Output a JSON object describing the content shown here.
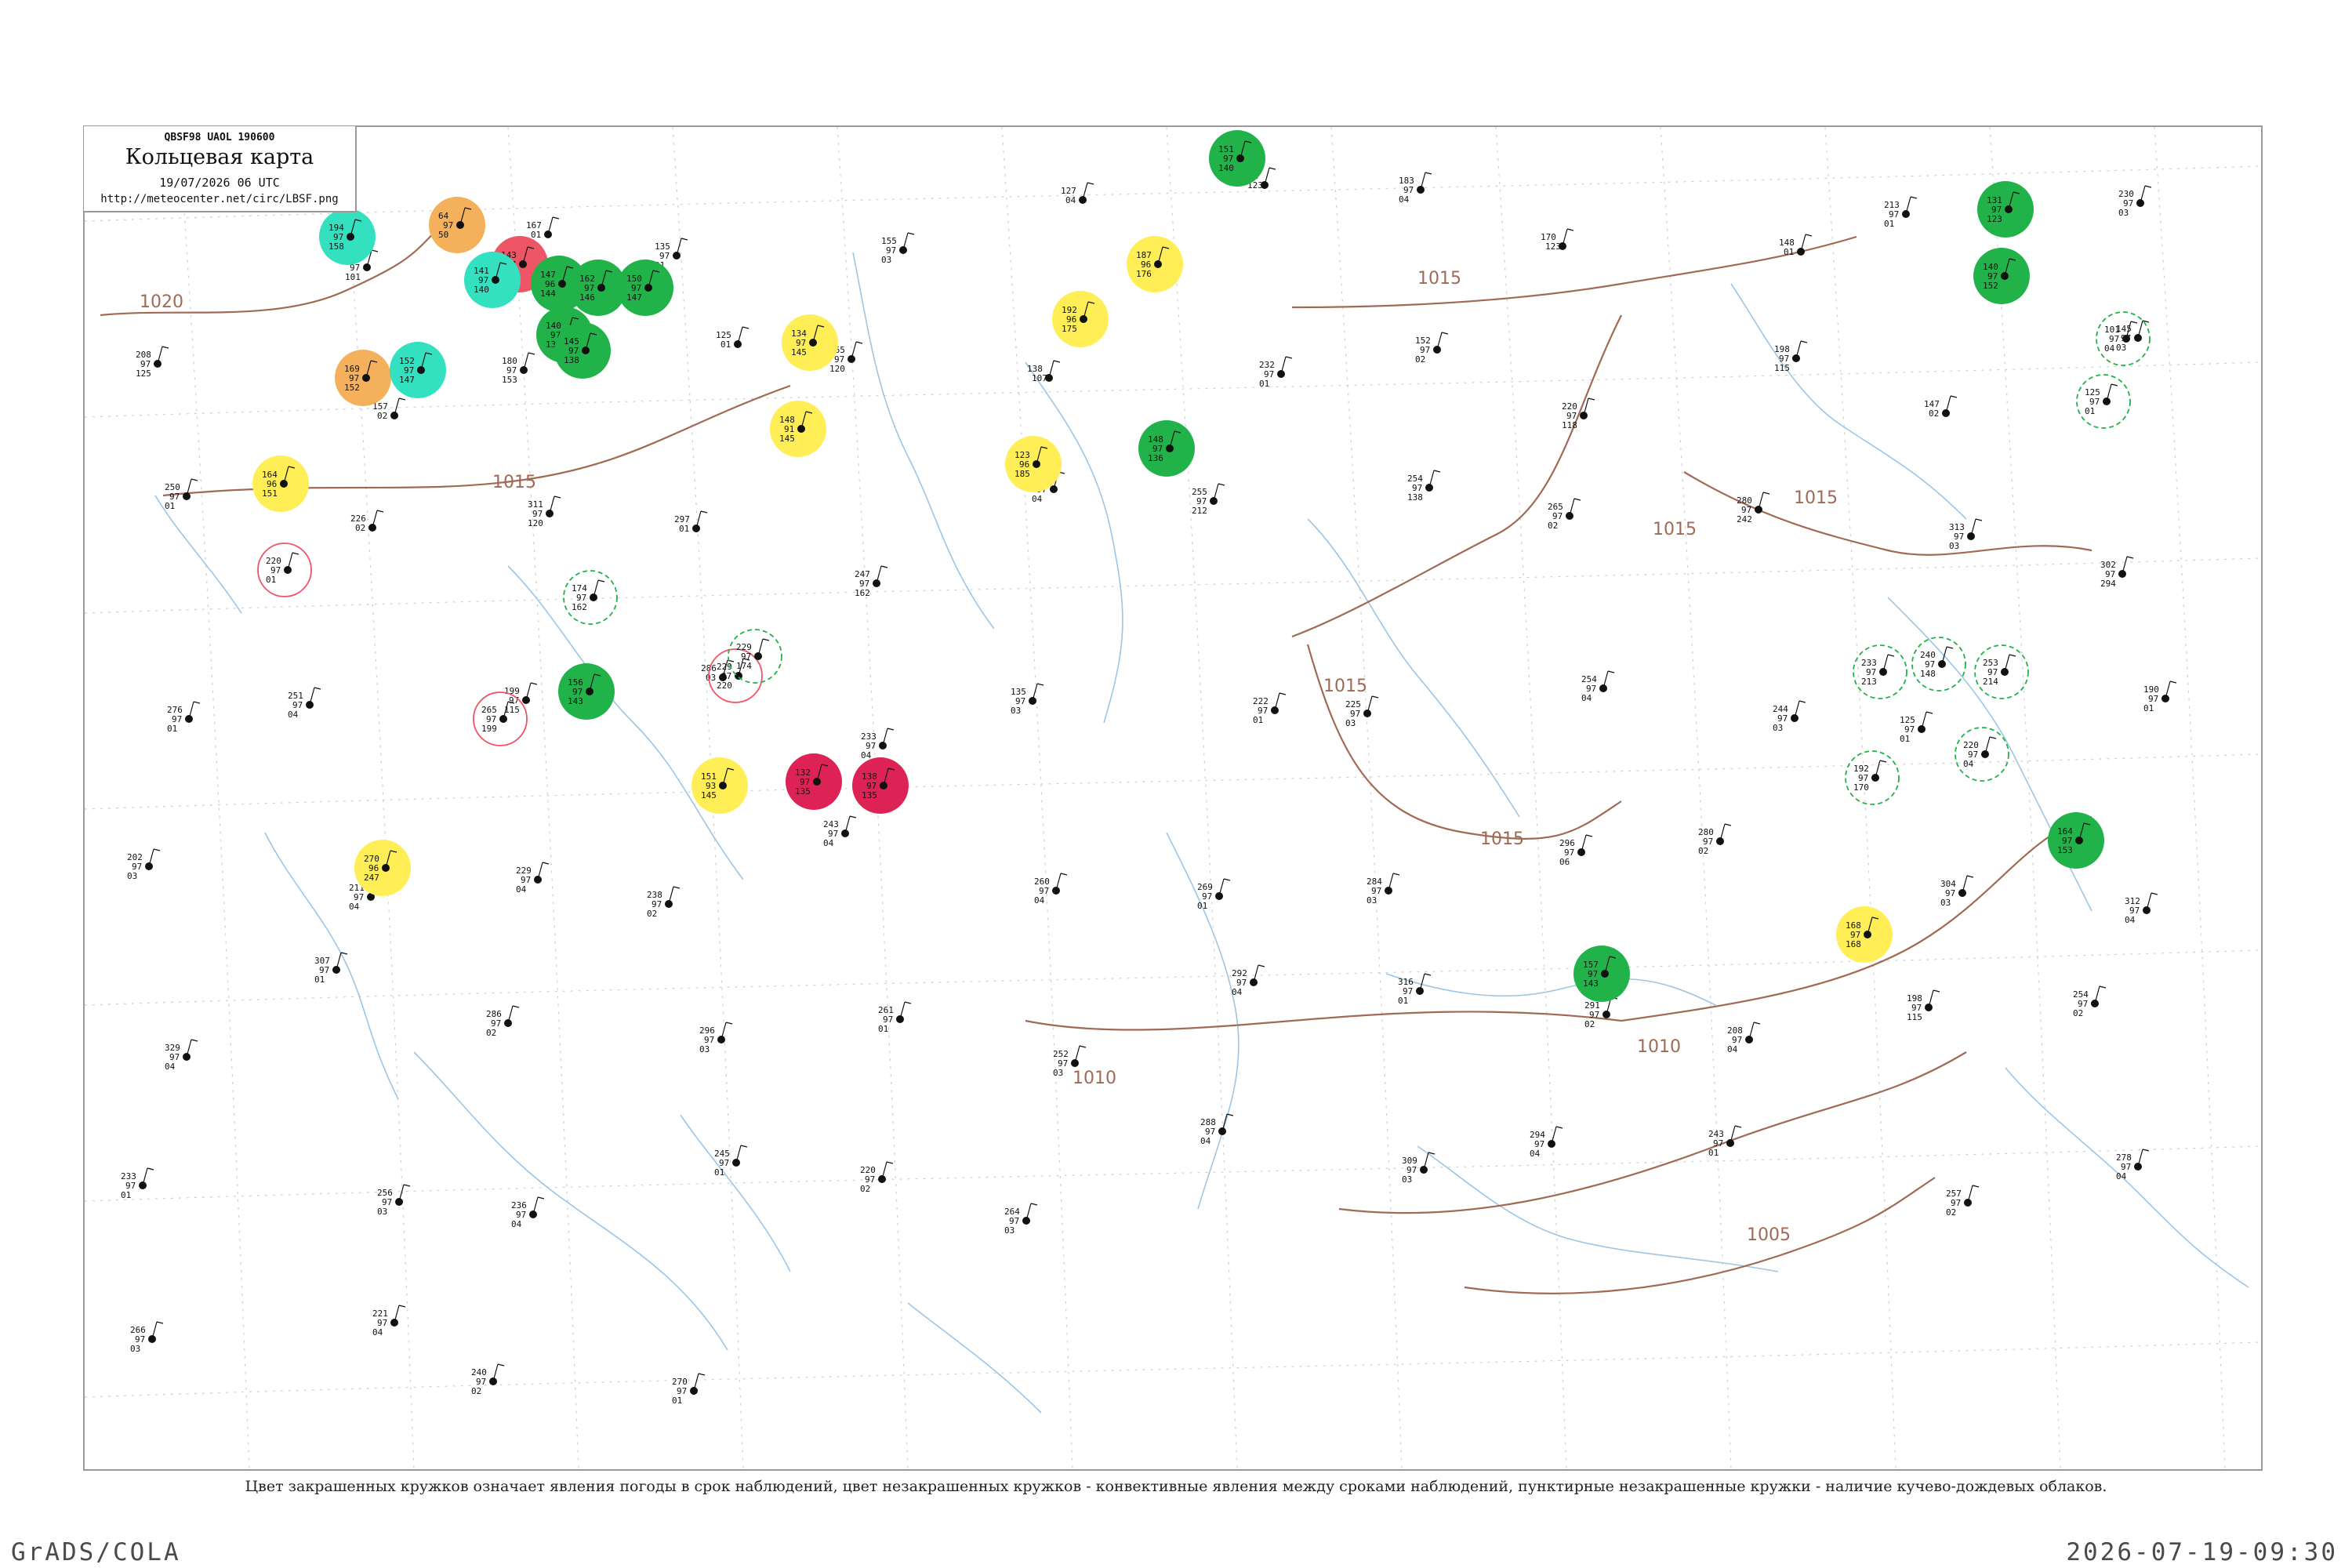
{
  "header": {
    "code": "QBSF98  UAOL  190600",
    "title": "Кольцевая карта",
    "date": "19/07/2026 06 UTC",
    "url": "http://meteocenter.net/circ/LBSF.png"
  },
  "caption": "Цвет закрашенных кружков означает явления погоды в срок наблюдений, цвет незакрашенных кружков - конвективные явления между сроками наблюдений, пунктирные незакрашенные кружки - наличие кучево-дождевых облаков.",
  "footer": {
    "left": "GrADS/COLA",
    "right": "2026-07-19-09:30"
  },
  "colors": {
    "river": "#9cc6e4",
    "isobar": "#a06a55",
    "green": "#22b24a",
    "yellow": "#ffee55",
    "orange": "#f4b05a",
    "red": "#ee5566",
    "crimson": "#dd2255",
    "cyan": "#33e0c0"
  },
  "isobar_labels": [
    "1020",
    "1015",
    "1015",
    "1015",
    "1015",
    "1015",
    "1015",
    "1010",
    "1010",
    "1005"
  ],
  "stations": [
    {
      "p": "158",
      "t": "97",
      "d": "111"
    },
    {
      "p": "206",
      "t": "97",
      "d": "101"
    },
    {
      "p": "167",
      "t": "01"
    },
    {
      "p": "135",
      "t": "97",
      "d": "01"
    },
    {
      "p": "155",
      "t": "97",
      "d": "03"
    },
    {
      "p": "127",
      "t": "04"
    },
    {
      "p": "161",
      "t": "123"
    },
    {
      "p": "183",
      "t": "97",
      "d": "04"
    },
    {
      "p": "170",
      "t": "123"
    },
    {
      "p": "148",
      "t": "01"
    },
    {
      "p": "213",
      "t": "97",
      "d": "01"
    },
    {
      "p": "230",
      "t": "97",
      "d": "03"
    },
    {
      "p": "208",
      "t": "97",
      "d": "125"
    },
    {
      "p": "157",
      "t": "02"
    },
    {
      "p": "180",
      "t": "97",
      "d": "153"
    },
    {
      "p": "125",
      "t": "01"
    },
    {
      "p": "165",
      "t": "97",
      "d": "120"
    },
    {
      "p": "138",
      "t": "107"
    },
    {
      "p": "232",
      "t": "97",
      "d": "01"
    },
    {
      "p": "152",
      "t": "97",
      "d": "02"
    },
    {
      "p": "220",
      "t": "97",
      "d": "118"
    },
    {
      "p": "198",
      "t": "97",
      "d": "115"
    },
    {
      "p": "147",
      "t": "02"
    },
    {
      "p": "145",
      "t": "97",
      "d": "03"
    },
    {
      "p": "250",
      "t": "97",
      "d": "01"
    },
    {
      "p": "226",
      "t": "02"
    },
    {
      "p": "311",
      "t": "97",
      "d": "120"
    },
    {
      "p": "297",
      "t": "01"
    },
    {
      "p": "247",
      "t": "97",
      "d": "162"
    },
    {
      "p": "246",
      "t": "97",
      "d": "04"
    },
    {
      "p": "255",
      "t": "97",
      "d": "212"
    },
    {
      "p": "254",
      "t": "97",
      "d": "138"
    },
    {
      "p": "265",
      "t": "97",
      "d": "02"
    },
    {
      "p": "280",
      "t": "97",
      "d": "242"
    },
    {
      "p": "313",
      "t": "97",
      "d": "03"
    },
    {
      "p": "302",
      "t": "97",
      "d": "294"
    },
    {
      "p": "276",
      "t": "97",
      "d": "01"
    },
    {
      "p": "251",
      "t": "97",
      "d": "04"
    },
    {
      "p": "199",
      "t": "97",
      "d": "115"
    },
    {
      "p": "286",
      "t": "03"
    },
    {
      "p": "233",
      "t": "97",
      "d": "04"
    },
    {
      "p": "135",
      "t": "97",
      "d": "03"
    },
    {
      "p": "222",
      "t": "97",
      "d": "01"
    },
    {
      "p": "225",
      "t": "97",
      "d": "03"
    },
    {
      "p": "254",
      "t": "97",
      "d": "04"
    },
    {
      "p": "244",
      "t": "97",
      "d": "03"
    },
    {
      "p": "125",
      "t": "97",
      "d": "01"
    },
    {
      "p": "190",
      "t": "97",
      "d": "01"
    },
    {
      "p": "202",
      "t": "97",
      "d": "03"
    },
    {
      "p": "211",
      "t": "97",
      "d": "04"
    },
    {
      "p": "229",
      "t": "97",
      "d": "04"
    },
    {
      "p": "238",
      "t": "97",
      "d": "02"
    },
    {
      "p": "243",
      "t": "97",
      "d": "04"
    },
    {
      "p": "260",
      "t": "97",
      "d": "04"
    },
    {
      "p": "269",
      "t": "97",
      "d": "01"
    },
    {
      "p": "284",
      "t": "97",
      "d": "03"
    },
    {
      "p": "296",
      "t": "97",
      "d": "06"
    },
    {
      "p": "280",
      "t": "97",
      "d": "02"
    },
    {
      "p": "304",
      "t": "97",
      "d": "03"
    },
    {
      "p": "312",
      "t": "97",
      "d": "04"
    },
    {
      "p": "329",
      "t": "97",
      "d": "04"
    },
    {
      "p": "307",
      "t": "97",
      "d": "01"
    },
    {
      "p": "286",
      "t": "97",
      "d": "02"
    },
    {
      "p": "296",
      "t": "97",
      "d": "03"
    },
    {
      "p": "261",
      "t": "97",
      "d": "01"
    },
    {
      "p": "252",
      "t": "97",
      "d": "03"
    },
    {
      "p": "292",
      "t": "97",
      "d": "04"
    },
    {
      "p": "316",
      "t": "97",
      "d": "01"
    },
    {
      "p": "291",
      "t": "97",
      "d": "02"
    },
    {
      "p": "208",
      "t": "97",
      "d": "04"
    },
    {
      "p": "198",
      "t": "97",
      "d": "115"
    },
    {
      "p": "254",
      "t": "97",
      "d": "02"
    },
    {
      "p": "233",
      "t": "97",
      "d": "01"
    },
    {
      "p": "256",
      "t": "97",
      "d": "03"
    },
    {
      "p": "236",
      "t": "97",
      "d": "04"
    },
    {
      "p": "245",
      "t": "97",
      "d": "01"
    },
    {
      "p": "220",
      "t": "97",
      "d": "02"
    },
    {
      "p": "264",
      "t": "97",
      "d": "03"
    },
    {
      "p": "288",
      "t": "97",
      "d": "04"
    },
    {
      "p": "309",
      "t": "97",
      "d": "03"
    },
    {
      "p": "294",
      "t": "97",
      "d": "04"
    },
    {
      "p": "243",
      "t": "97",
      "d": "01"
    },
    {
      "p": "257",
      "t": "97",
      "d": "02"
    },
    {
      "p": "278",
      "t": "97",
      "d": "04"
    },
    {
      "p": "266",
      "t": "97",
      "d": "03"
    },
    {
      "p": "221",
      "t": "97",
      "d": "04"
    },
    {
      "p": "240",
      "t": "97",
      "d": "02"
    },
    {
      "p": "270",
      "t": "97",
      "d": "01"
    }
  ],
  "circled_stations": [
    {
      "color": "cyan",
      "filled": true,
      "p": "194",
      "t": "97",
      "d": "158"
    },
    {
      "color": "orange",
      "filled": true,
      "p": "64",
      "t": "97",
      "d": "50"
    },
    {
      "color": "red",
      "filled": true,
      "p": "143",
      "t": "97",
      "d": "153"
    },
    {
      "color": "cyan",
      "filled": true,
      "p": "141",
      "t": "97",
      "d": "140"
    },
    {
      "color": "green",
      "filled": true,
      "p": "147",
      "t": "96",
      "d": "144"
    },
    {
      "color": "green",
      "filled": true,
      "p": "162",
      "t": "97",
      "d": "146"
    },
    {
      "color": "green",
      "filled": true,
      "p": "150",
      "t": "97",
      "d": "147"
    },
    {
      "color": "green",
      "filled": true,
      "p": "140",
      "t": "97",
      "d": "137"
    },
    {
      "color": "green",
      "filled": true,
      "p": "145",
      "t": "97",
      "d": "138"
    },
    {
      "color": "orange",
      "filled": true,
      "p": "169",
      "t": "97",
      "d": "152"
    },
    {
      "color": "cyan",
      "filled": true,
      "p": "152",
      "t": "97",
      "d": "147"
    },
    {
      "color": "yellow",
      "filled": true,
      "p": "164",
      "t": "96",
      "d": "151"
    },
    {
      "color": "green",
      "filled": true,
      "p": "156",
      "t": "97",
      "d": "143"
    },
    {
      "color": "yellow",
      "filled": true,
      "p": "134",
      "t": "97",
      "d": "145"
    },
    {
      "color": "yellow",
      "filled": true,
      "p": "148",
      "t": "91",
      "d": "145"
    },
    {
      "color": "yellow",
      "filled": true,
      "p": "151",
      "t": "93",
      "d": "145"
    },
    {
      "color": "crimson",
      "filled": true,
      "p": "132",
      "t": "97",
      "d": "135"
    },
    {
      "color": "crimson",
      "filled": true,
      "p": "138",
      "t": "97",
      "d": "135"
    },
    {
      "color": "yellow",
      "filled": true,
      "p": "192",
      "t": "96",
      "d": "175"
    },
    {
      "color": "yellow",
      "filled": true,
      "p": "123",
      "t": "96",
      "d": "185"
    },
    {
      "color": "yellow",
      "filled": true,
      "p": "187",
      "t": "96",
      "d": "176"
    },
    {
      "color": "green",
      "filled": true,
      "p": "148",
      "t": "97",
      "d": "136"
    },
    {
      "color": "green",
      "filled": true,
      "p": "151",
      "t": "97",
      "d": "140"
    },
    {
      "color": "yellow",
      "filled": true,
      "p": "270",
      "t": "96",
      "d": "247"
    },
    {
      "color": "yellow",
      "filled": true,
      "p": "168",
      "t": "97",
      "d": "168"
    },
    {
      "color": "green",
      "filled": true,
      "p": "157",
      "t": "97",
      "d": "143"
    },
    {
      "color": "green",
      "filled": true,
      "p": "131",
      "t": "97",
      "d": "123"
    },
    {
      "color": "green",
      "filled": true,
      "p": "140",
      "t": "97",
      "d": "152"
    },
    {
      "color": "green",
      "filled": true,
      "p": "164",
      "t": "97",
      "d": "153"
    },
    {
      "color": "red",
      "filled": false,
      "p": "220",
      "t": "97",
      "d": "01"
    },
    {
      "color": "red",
      "filled": false,
      "p": "229",
      "t": "97",
      "d": "220"
    },
    {
      "color": "red",
      "filled": false,
      "p": "265",
      "t": "97",
      "d": "199"
    },
    {
      "color": "green",
      "filled": false,
      "p": "174",
      "t": "97",
      "d": "162"
    },
    {
      "color": "green",
      "filled": false,
      "p": "229",
      "t": "97",
      "d": "174"
    },
    {
      "color": "green",
      "filled": false,
      "p": "233",
      "t": "97",
      "d": "213"
    },
    {
      "color": "green",
      "filled": false,
      "p": "240",
      "t": "97",
      "d": "148"
    },
    {
      "color": "green",
      "filled": false,
      "p": "253",
      "t": "97",
      "d": "214"
    },
    {
      "color": "green",
      "filled": false,
      "p": "220",
      "t": "97",
      "d": "04"
    },
    {
      "color": "green",
      "filled": false,
      "p": "192",
      "t": "97",
      "d": "170"
    },
    {
      "color": "green",
      "filled": false,
      "p": "125",
      "t": "97",
      "d": "01"
    },
    {
      "color": "green",
      "filled": false,
      "p": "101",
      "t": "97",
      "d": "04"
    }
  ]
}
